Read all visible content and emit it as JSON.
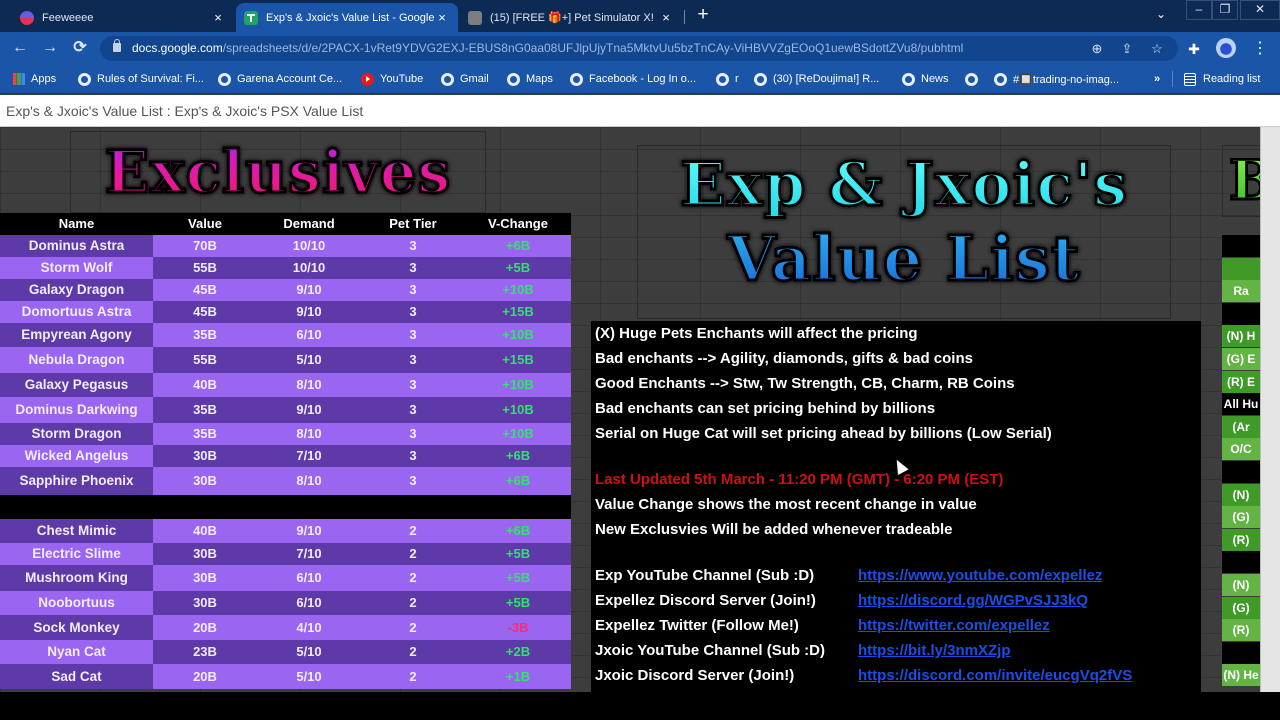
{
  "browser": {
    "tabs": [
      {
        "title": "Feeweeee",
        "active": false,
        "favicon": "profile-badge-icon"
      },
      {
        "title": "Exp's & Jxoic's Value List - Google",
        "active": true,
        "favicon": "google-sheets-icon"
      },
      {
        "title": "(15) [FREE 🎁+] Pet Simulator X!",
        "active": false,
        "favicon": "roblox-icon"
      }
    ],
    "tab_close": "×",
    "new_tab": "+",
    "tab_search": "⌄",
    "window_controls": {
      "minimize": "–",
      "restore": "❐",
      "close": "✕"
    },
    "url_host": "docs.google.com",
    "url_path": "/spreadsheets/d/e/2PACX-1vRet9YDVG2EXJ-EBUS8nG0aa08UFJlpUjyTna5MktvUu5bzTnCAy-ViHBVVZgEOoQ1uewBSdottZVu8/pubhtml",
    "nav": {
      "back": "←",
      "forward": "→",
      "reload": "⟳"
    },
    "omnibox_icons": {
      "zoom": "⊕",
      "share": "⇪",
      "bookmark": "☆"
    },
    "toolbar_icons": {
      "extensions": "✚",
      "menu": "⋮"
    },
    "bookmarks": [
      {
        "label": "Apps",
        "icon": "apps-grid-icon"
      },
      {
        "label": "Rules of Survival: Fi...",
        "icon": "globe-icon"
      },
      {
        "label": "Garena Account Ce...",
        "icon": "globe-icon"
      },
      {
        "label": "YouTube",
        "icon": "youtube-icon"
      },
      {
        "label": "Gmail",
        "icon": "globe-icon"
      },
      {
        "label": "Maps",
        "icon": "globe-icon"
      },
      {
        "label": "Facebook - Log In o...",
        "icon": "globe-icon"
      },
      {
        "label": "r",
        "icon": "globe-icon"
      },
      {
        "label": "(30) [ReDoujima!] R...",
        "icon": "globe-icon"
      },
      {
        "label": "News",
        "icon": "globe-icon"
      },
      {
        "label": "",
        "icon": "globe-icon"
      },
      {
        "label": "#🔲trading-no-imag...",
        "icon": "globe-icon"
      }
    ],
    "bookmarks_overflow": "»",
    "reading_list": "Reading list"
  },
  "page": {
    "published_title": "Exp's & Jxoic's Value List : Exp's & Jxoic's PSX Value List",
    "exclusives_banner": "Exclusives",
    "main_banner_line1": "Exp & Jxoic's",
    "main_banner_line2": "Value List",
    "right_banner_partial": "B"
  },
  "table": {
    "headers": [
      "Name",
      "Value",
      "Demand",
      "Pet Tier",
      "V-Change"
    ],
    "tier3": [
      {
        "name": "Dominus Astra",
        "value": "70B",
        "demand": "10/10",
        "tier": "3",
        "change": "+6B"
      },
      {
        "name": "Storm Wolf",
        "value": "55B",
        "demand": "10/10",
        "tier": "3",
        "change": "+5B"
      },
      {
        "name": "Galaxy Dragon",
        "value": "45B",
        "demand": "9/10",
        "tier": "3",
        "change": "+10B"
      },
      {
        "name": "Domortuus Astra",
        "value": "45B",
        "demand": "9/10",
        "tier": "3",
        "change": "+15B"
      },
      {
        "name": "Empyrean Agony",
        "value": "35B",
        "demand": "6/10",
        "tier": "3",
        "change": "+10B"
      },
      {
        "name": "Nebula Dragon",
        "value": "55B",
        "demand": "5/10",
        "tier": "3",
        "change": "+15B"
      },
      {
        "name": "Galaxy Pegasus",
        "value": "40B",
        "demand": "8/10",
        "tier": "3",
        "change": "+10B"
      },
      {
        "name": "Dominus Darkwing",
        "value": "35B",
        "demand": "9/10",
        "tier": "3",
        "change": "+10B"
      },
      {
        "name": "Storm Dragon",
        "value": "35B",
        "demand": "8/10",
        "tier": "3",
        "change": "+10B"
      },
      {
        "name": "Wicked Angelus",
        "value": "30B",
        "demand": "7/10",
        "tier": "3",
        "change": "+6B"
      },
      {
        "name": "Sapphire Phoenix",
        "value": "30B",
        "demand": "8/10",
        "tier": "3",
        "change": "+6B"
      }
    ],
    "tier2": [
      {
        "name": "Chest Mimic",
        "value": "40B",
        "demand": "9/10",
        "tier": "2",
        "change": "+6B"
      },
      {
        "name": "Electric Slime",
        "value": "30B",
        "demand": "7/10",
        "tier": "2",
        "change": "+5B"
      },
      {
        "name": "Mushroom King",
        "value": "30B",
        "demand": "6/10",
        "tier": "2",
        "change": "+5B"
      },
      {
        "name": "Noobortuus",
        "value": "30B",
        "demand": "6/10",
        "tier": "2",
        "change": "+5B"
      },
      {
        "name": "Sock Monkey",
        "value": "20B",
        "demand": "4/10",
        "tier": "2",
        "change": "-3B"
      },
      {
        "name": "Nyan Cat",
        "value": "23B",
        "demand": "5/10",
        "tier": "2",
        "change": "+2B"
      },
      {
        "name": "Sad Cat",
        "value": "20B",
        "demand": "5/10",
        "tier": "2",
        "change": "+1B"
      }
    ]
  },
  "info": {
    "notes": [
      "(X) Huge Pets Enchants will affect the pricing",
      "Bad enchants --> Agility, diamonds, gifts & bad coins",
      "Good Enchants --> Stw, Tw Strength, CB, Charm, RB Coins",
      "Bad enchants can set pricing behind by billions",
      "Serial on Huge Cat will set pricing ahead by billions (Low Serial)"
    ],
    "last_updated": "Last Updated 5th March - 11:20 PM (GMT) - 6:20 PM (EST)",
    "notes2": [
      "Value Change shows the most recent change in value",
      "New Exclusvies Will be added whenever tradeable"
    ],
    "links": [
      {
        "label": "Exp YouTube Channel (Sub :D)",
        "url": "https://www.youtube.com/expellez"
      },
      {
        "label": "Expellez Discord Server (Join!)",
        "url": "https://discord.gg/WGPvSJJ3kQ"
      },
      {
        "label": "Expellez Twitter (Follow Me!)",
        "url": "https://twitter.com/expellez"
      },
      {
        "label": "Jxoic YouTube Channel (Sub :D)",
        "url": "https://bit.ly/3nmXZjp"
      },
      {
        "label": "Jxoic Discord Server (Join!)",
        "url": "https://discord.com/invite/eucgVq2fVS"
      }
    ]
  },
  "green_column": [
    {
      "text": "",
      "style": "blk"
    },
    {
      "text": "",
      "style": "g1"
    },
    {
      "text": "Ra",
      "style": "g2"
    },
    {
      "text": "",
      "style": "blk"
    },
    {
      "text": "(N) H",
      "style": "g1"
    },
    {
      "text": "(G) E",
      "style": "g2"
    },
    {
      "text": "(R) E",
      "style": "g1"
    },
    {
      "text": "All Hu",
      "style": "blk"
    },
    {
      "text": "(Ar",
      "style": "g1"
    },
    {
      "text": "O/C",
      "style": "g2"
    },
    {
      "text": "",
      "style": "blk"
    },
    {
      "text": "(N)",
      "style": "g1"
    },
    {
      "text": "(G)",
      "style": "g2"
    },
    {
      "text": "(R)",
      "style": "g1"
    },
    {
      "text": "",
      "style": "blk"
    },
    {
      "text": "(N)",
      "style": "g2"
    },
    {
      "text": "(G)",
      "style": "g1"
    },
    {
      "text": "(R)",
      "style": "g2"
    },
    {
      "text": "",
      "style": "blk"
    },
    {
      "text": "(N) He",
      "style": "g2"
    }
  ],
  "colors": {
    "row_dark": "#5d3aa8",
    "row_light": "#9a65f0",
    "change_positive": "#30e36d",
    "change_negative": "#ff2a77",
    "link": "#1a4ee8",
    "updated_red": "#d01010",
    "chrome_blue": "#1a55a8"
  }
}
